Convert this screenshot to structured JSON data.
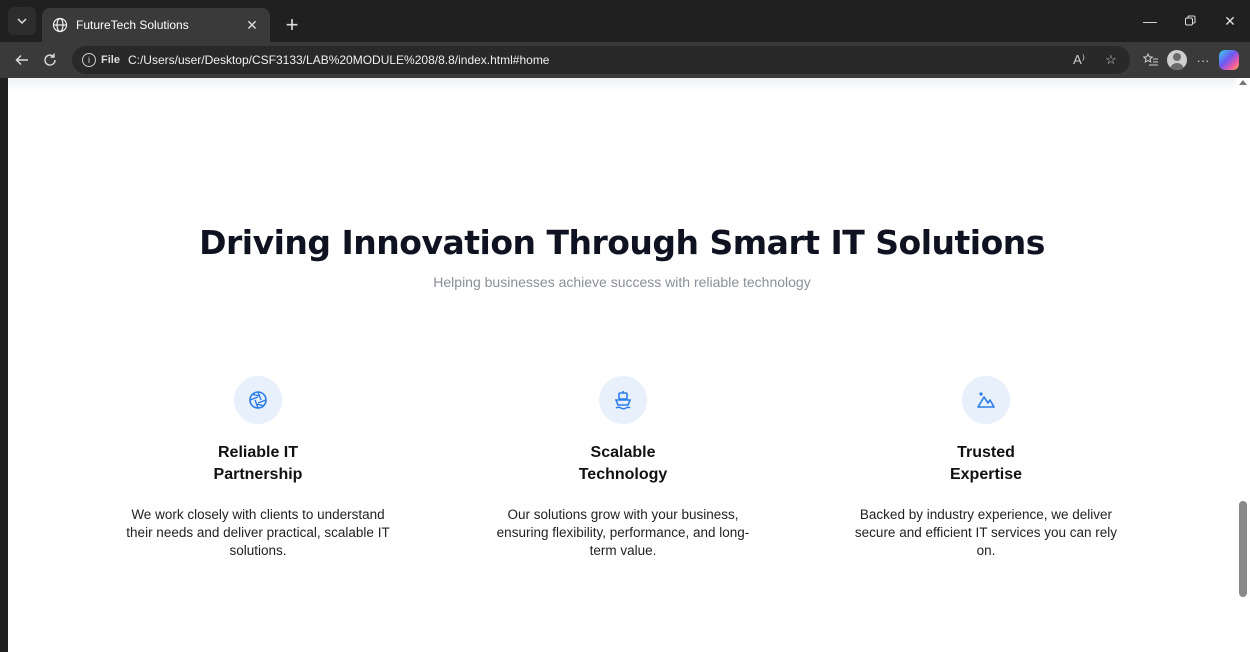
{
  "browser": {
    "tab_title": "FutureTech Solutions",
    "address_label": "File",
    "url": "C:/Users/user/Desktop/CSF3133/LAB%20MODULE%208/8.8/index.html#home",
    "read_aloud_label": "A⁾"
  },
  "hero": {
    "title": "Driving Innovation Through Smart IT Solutions",
    "subtitle": "Helping businesses achieve success with reliable technology"
  },
  "features": [
    {
      "icon": "aperture-icon",
      "title_line1": "Reliable IT",
      "title_line2": "Partnership",
      "desc_line1": "We work closely with clients to understand",
      "desc_line2": "their needs and deliver practical, scalable IT",
      "desc_line3": "solutions."
    },
    {
      "icon": "ship-icon",
      "title_line1": "Scalable",
      "title_line2": "Technology",
      "desc_line1": "Our solutions grow with your business,",
      "desc_line2": "ensuring flexibility, performance, and long-",
      "desc_line3": "term value."
    },
    {
      "icon": "mountain-icon",
      "title_line1": "Trusted",
      "title_line2": "Expertise",
      "desc_line1": "Backed by industry experience, we deliver",
      "desc_line2": "secure and efficient IT services you can rely",
      "desc_line3": "on."
    }
  ],
  "colors": {
    "accent": "#2b7de9",
    "icon_bg": "#e7f0fb"
  }
}
